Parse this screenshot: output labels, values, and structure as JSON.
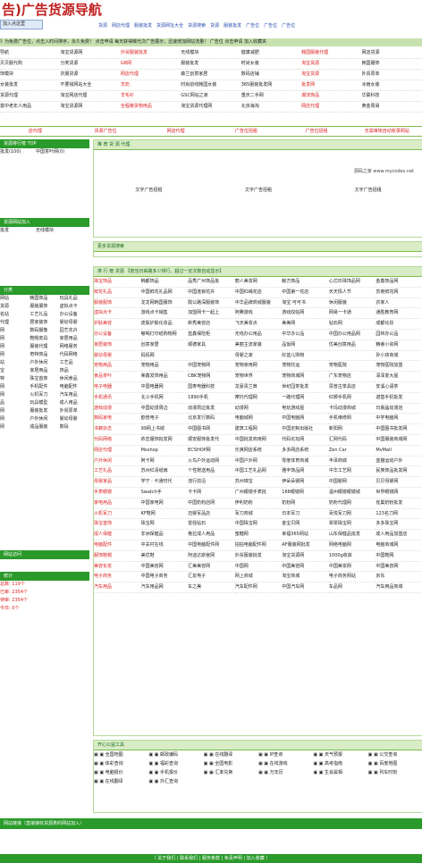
{
  "header": {
    "logo": "告)广告货源导航",
    "add_btn": "加入点这里",
    "nav": [
      "货源",
      "网店代理",
      "服装批发",
      "货源网址大全",
      "货源搜索",
      "货源",
      "服装批发",
      "广告位",
      "广告位",
      "广告位"
    ],
    "announce": "》为免费广告位，点击入时间排序，永久免费！ 点击申请 每天获得曝光次广告展示，迅速增加网站流量！ 广告位 点击申请 加入收藏夹"
  },
  "top_grid": [
    [
      "导航",
      "淘宝货源网",
      "外贸服装批发",
      "无线模块",
      "健康减肥",
      "韩国服装代理",
      "网店货源"
    ],
    [
      "贝贝服代购",
      "分类货源",
      "GB网",
      "服装批发",
      "时尚女装",
      "淘宝货源",
      "韩国服饰"
    ],
    [
      "饰模块",
      "衣服货源",
      "网店代理",
      "森兰创意家居",
      "数码店铺",
      "淘宝货源",
      "外贸原单"
    ],
    [
      "女装批发",
      "不要钱网站大全",
      "羊奶",
      "时尚前线韩国女装",
      "365服装批发网",
      "批发网",
      "冰雨女装"
    ],
    [
      "货源代理",
      "淘宝网店代理",
      "羊毛衫",
      "GSC网站之家",
      "重庆二手网",
      "潮流饰品",
      "华联科技"
    ],
    [
      "富中老年人用品",
      "淘宝货源网",
      "全程嘟货物用品",
      "淘宝货源代理网",
      "北京海淘",
      "网店代理",
      "黄金周易"
    ]
  ],
  "ad_row": [
    "店代理",
    "货源广告位",
    "网店代理",
    "广告位招租",
    "广告位招租",
    "无需审核自动收录网站"
  ],
  "left_rank_title": "货源排行榜 TOP",
  "left_rank": [
    "批发(100)",
    "代理(0)",
    "招租(0)",
    "网(0)",
    "批发(0)",
    "网(0)"
  ],
  "left_rank2": [
    "中国茶叶网(0)",
    "衣服库存网(0)",
    "北京时尚网(0)",
    "手机小说网(0)",
    "衣服货源网(0)",
    "淘宝货源网(0)"
  ],
  "left_new_title": "货源网站加入",
  "left_new": [
    "批发",
    "装网",
    "品代理",
    "货源网",
    "宝网"
  ],
  "left_new2": [
    "无线模块",
    "衣服货源",
    "女装批发",
    "衣服购物",
    "GSC网站之家",
    "淘宝网店代理"
  ],
  "left_cat_title": "分类",
  "left_cat": [
    [
      "网站",
      "韩国饰品",
      "玩具礼品"
    ],
    [
      "货源",
      "服装服饰",
      "虚拟点卡"
    ],
    [
      "名站",
      "工艺礼品",
      "办公设备"
    ],
    [
      "代理",
      "居家装饰",
      "婴幼母婴"
    ],
    [
      "网",
      "数码摄像",
      "园艺花卉"
    ],
    [
      "网",
      "鞋帽皮具",
      "家居用品"
    ],
    [
      "网",
      "服装代理",
      "网络服务"
    ],
    [
      "网",
      "奇特饰品",
      "代码网络"
    ],
    [
      "站",
      "户外休闲",
      "工艺品"
    ],
    [
      "宝",
      "家居用品",
      "饰品"
    ],
    [
      "特",
      "珠宝首饰",
      "休闲食品"
    ],
    [
      "网",
      "手机配件",
      "电脑配件"
    ],
    [
      "网",
      "火机军刀",
      "汽车用品"
    ],
    [
      "品",
      "玩具模型",
      "成人用品"
    ],
    [
      "网",
      "服装批发",
      "外贸原单"
    ],
    [
      "网",
      "户外休闲",
      "婴幼母婴"
    ],
    [
      "网",
      "成品服装",
      "数码"
    ]
  ],
  "left_stat_title": "统计",
  "left_stat": [
    "总数: 119个",
    "已审: 2354个",
    "待审: 2354个",
    "今日: 0个"
  ],
  "left_visit_title": "网站访问",
  "main_hot_title": "推 荐 货 源 代理",
  "hot_caption": "源码之家 www.mycodes.net",
  "hot_ads": [
    "文字广告招租",
    "文字广告招租",
    "文字广告招租"
  ],
  "main_new_title": "更多货源搜索",
  "main_list_title": "排 行 榜 货源 【按当日来路多少排行，超过一定次数自动显示】",
  "main_list": [
    [
      "珠宝饰品",
      "韩都饰品",
      "品秀广州饰品批",
      "丽人美妆网",
      "献方饰品",
      "心芯珍珠饰品网",
      "金鑫饰品网"
    ],
    [
      "鲜花礼品",
      "中国鲜花礼品网",
      "中国连锁花卉",
      "中国红绳花店",
      "中国第一花店",
      "天天情人节",
      "苏南鲜花网"
    ],
    [
      "服装服饰",
      "龙龙网韩国服饰",
      "陇公路深服装饰",
      "中华品牌商城服装",
      "淘宝 可可书",
      "休闲服装",
      "衣家人"
    ],
    [
      "虚拟点卡",
      "游戏点卡销售",
      "加盟网卡一起上",
      "阿腾游戏",
      "游戏纹帖网",
      "网易一卡通",
      "通胜教育网"
    ],
    [
      "护肤美容",
      "皮肤护肤化妆品",
      "新秀美容店",
      "飞天美妆点",
      "美美网",
      "钻石网",
      "成都化妆"
    ],
    [
      "办公设备",
      "嘟喝打印纸购物网",
      "蓝鑫保险柜",
      "无线办公用品",
      "中华办公品",
      "中国办公用品网",
      "园林办公品"
    ],
    [
      "家居装饰",
      "创意家居",
      "顺德家具",
      "美丽主流家装",
      "品饭网",
      "优美创意用品",
      "精睿小资网"
    ],
    [
      "婴幼母婴",
      "妈妈网",
      "",
      "母婴之家",
      "红蓝儿购物",
      "",
      "孙小孩商城"
    ],
    [
      "宠物用品",
      "宠物用品",
      "中国宠物网",
      "宠物家用网",
      "宠物托运",
      "宠物医院",
      "宠物医院加盟"
    ],
    [
      "食品茶叶",
      "荣鑫发饰用品",
      "CBK宠物网",
      "宠物世界",
      "宠物商城网",
      "广东宠物店",
      "深泽复大屋"
    ],
    [
      "电子电器",
      "中国电器网",
      "国寿电器科技",
      "龙豪贵兰茸",
      "世纪园茶批发",
      "思普古茶具店",
      "安溪心语茶"
    ],
    [
      "手机通讯",
      "北斗手机网",
      "1890手机",
      "摩托代理网",
      "一路代理网",
      "红狮手机网",
      "诺基手机批发"
    ],
    [
      "游戏动漫",
      "中国动漫周边",
      "动漫周边批发",
      "动漫网",
      "电玩游戏屋",
      "卡玛动漫商城",
      "日晨晶动漫店"
    ],
    [
      "数码家电",
      "欧普电子",
      "北京发行数码",
      "电脑城网",
      "中国电脑网",
      "手机维修网",
      "中学电脑网"
    ],
    [
      "书籍杂志",
      "99网上书城",
      "中国图书网",
      "建筑工程网",
      "中国定制出版社",
      "新阳网",
      "中国图书批发网"
    ],
    [
      "代码网络",
      "依恋服饰批发网",
      "顺安服饰批发代",
      "中国批发商用网",
      "代码论坛网",
      "汇网代码",
      "中国服装商城网"
    ],
    [
      "网店代理",
      "Mxshop",
      "ECSHOP网",
      "乐爽网店系统",
      "多多网店系统",
      "Zen Car",
      "MvMall"
    ],
    [
      "户外休闲",
      "阿卡网",
      "火鸟户外运动网",
      "中国户外网",
      "零度体育商城",
      "丰泽商城",
      "蓝猫运动户外"
    ],
    [
      "工艺礼品",
      "苏州红清纸扇",
      "个性赠送用品",
      "中国工艺礼品网",
      "雅丰饰品网",
      "中华工艺网",
      "民族饰品批发网"
    ],
    [
      "母婴家品",
      "学宁 · 卡通时代",
      "流行前沿",
      "苏州锦宝",
      "伊朵朵婴网",
      "中国婴网",
      "贝贝母婴网"
    ],
    [
      "手表眼镜",
      "Swatch手",
      "卡卡网",
      "广州眼镜手表批",
      "168眼镜网",
      "温州眼镜眼镜城",
      "世界眼镜网"
    ],
    [
      "家电用品",
      "中国家电网",
      "中国奶粉店网",
      "伊利奶粉",
      "奶粉网",
      "奶粉代理网",
      "雀巢奶粉批发"
    ],
    [
      "火机军刀",
      "KF鞋网",
      "迈婴军品店",
      "军刀商城",
      "日本军刀",
      "百悦军刀网",
      "123名刀网"
    ],
    [
      "珠宝首饰",
      "珠宝网",
      "雷强钻石",
      "中国珠宝网",
      "金宝贝网",
      "翠翠珠宝网",
      "多多珠宝网"
    ],
    [
      "成人保健",
      "非洲保健品",
      "格拉成人用品",
      "蜜糖网",
      "幸福365网站",
      "山东保健品批发",
      "成人用品加盟店"
    ],
    [
      "电脑配件",
      "中关村在线",
      "中国电脑配件网",
      "拍拍电脑配件网",
      "AF服装网批发",
      "网络电脑网",
      "电脑商城网"
    ],
    [
      "服饰鞋帽",
      "美优鞋",
      "阿迪达斯官网",
      "外贸服装批发",
      "淘宝货源网",
      "1000g收获",
      "中国鞋网"
    ],
    [
      "美容化妆",
      "中国美容网",
      "汇美美容网",
      "中国网",
      "中国美容网",
      "中国美妆网",
      "中国美容网"
    ],
    [
      "电子商务",
      "中国电子商务",
      "汇友电子",
      "网上商城",
      "淘宝商城",
      "电子商务网站",
      "京东"
    ],
    [
      "汽车用品",
      "汽车用品网",
      "车之美",
      "汽车配件网",
      "中国汽车网",
      "车品网",
      "汽车用品商城"
    ]
  ],
  "main_links_title": "开心公益工具",
  "tools": [
    "全国地图",
    "邮政编码",
    "在线翻译",
    "IP查询",
    "天气预报",
    "公交查询",
    "体彩查询",
    "福彩查询",
    "全国电影",
    "在线游戏",
    "高考指南",
    "百度地图",
    "电脑报价",
    "手机报价",
    "汇率兑换",
    "万年历",
    "生肖属相",
    "列车时刻",
    "在线翻译",
    "外汇查询",
    "",
    "",
    "",
    ""
  ],
  "left_links_title": "网站链接（直接接收货源类的网站加入）",
  "footer_text": "（ 关于我们 | 联系我们 | 服务条款 | 免责声明 | 加入收藏 ）"
}
